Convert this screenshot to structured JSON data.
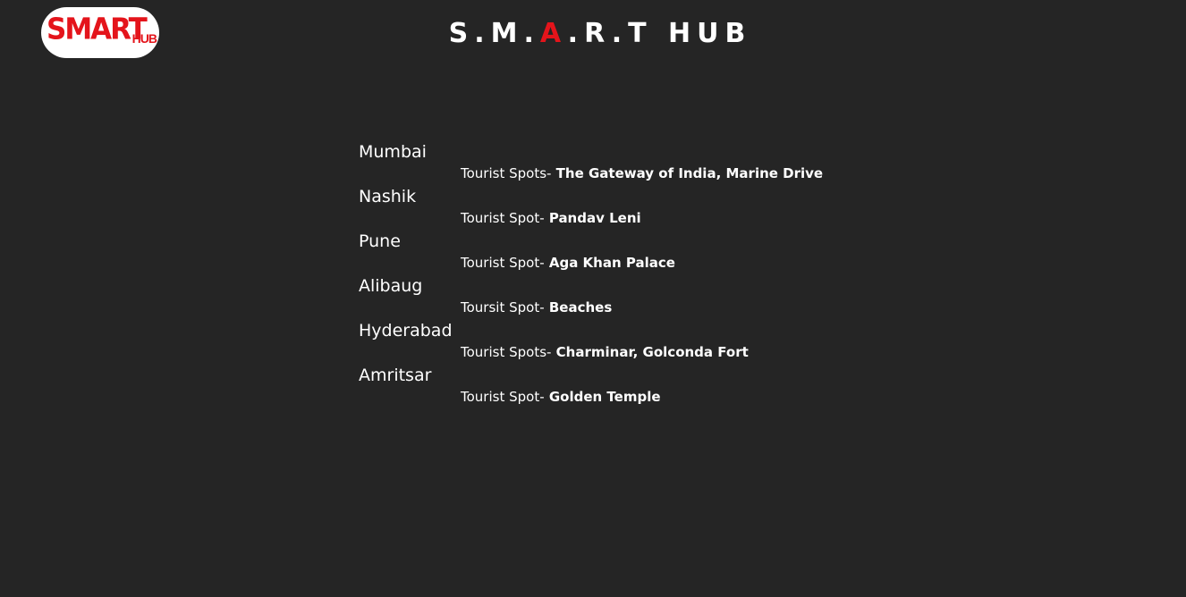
{
  "header": {
    "logo_text": "SMART",
    "logo_suffix": "HUB",
    "title_before": "S.M.",
    "title_accent": "A",
    "title_after": ".R.T  HUB"
  },
  "cities": [
    {
      "name": "Mumbai",
      "spot_label": "Tourist Spots-",
      "spot_value": " The Gateway of India, Marine Drive"
    },
    {
      "name": "Nashik",
      "spot_label": "Tourist Spot-",
      "spot_value": " Pandav Leni"
    },
    {
      "name": "Pune",
      "spot_label": "Tourist Spot-",
      "spot_value": " Aga Khan Palace"
    },
    {
      "name": "Alibaug",
      "spot_label": "Toursit Spot-",
      "spot_value": " Beaches"
    },
    {
      "name": "Hyderabad",
      "spot_label": "Tourist Spots-",
      "spot_value": " Charminar, Golconda Fort"
    },
    {
      "name": "Amritsar",
      "spot_label": "Tourist Spot-",
      "spot_value": " Golden Temple"
    }
  ],
  "colors": {
    "background": "#252525",
    "accent": "#e4141b",
    "text": "#ffffff"
  }
}
